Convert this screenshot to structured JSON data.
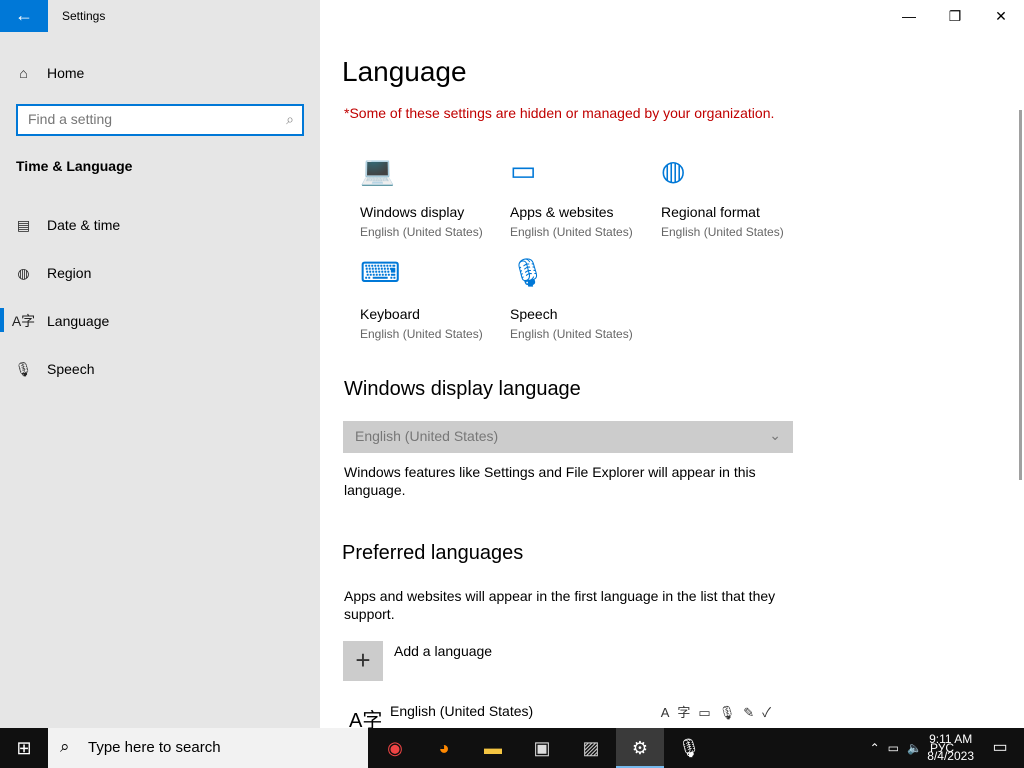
{
  "app": {
    "title": "Settings"
  },
  "nav": {
    "home": "Home",
    "search_placeholder": "Find a setting",
    "section": "Time & Language",
    "items": [
      {
        "label": "Date & time"
      },
      {
        "label": "Region"
      },
      {
        "label": "Language"
      },
      {
        "label": "Speech"
      }
    ]
  },
  "page": {
    "title": "Language",
    "warning": "*Some of these settings are hidden or managed by your organization.",
    "tiles": [
      {
        "title": "Windows display",
        "sub": "English (United States)"
      },
      {
        "title": "Apps & websites",
        "sub": "English (United States)"
      },
      {
        "title": "Regional format",
        "sub": "English (United States)"
      },
      {
        "title": "Keyboard",
        "sub": "English (United States)"
      },
      {
        "title": "Speech",
        "sub": "English (United States)"
      }
    ],
    "display": {
      "heading": "Windows display language",
      "value": "English (United States)",
      "desc": "Windows features like Settings and File Explorer will appear in this language."
    },
    "preferred": {
      "heading": "Preferred languages",
      "desc": "Apps and websites will appear in the first language in the list that they support.",
      "add": "Add a language",
      "lang": "English (United States)"
    }
  },
  "taskbar": {
    "search": "Type here to search",
    "input_lang": "РУС",
    "time": "9:11 AM",
    "date": "8/4/2023"
  }
}
